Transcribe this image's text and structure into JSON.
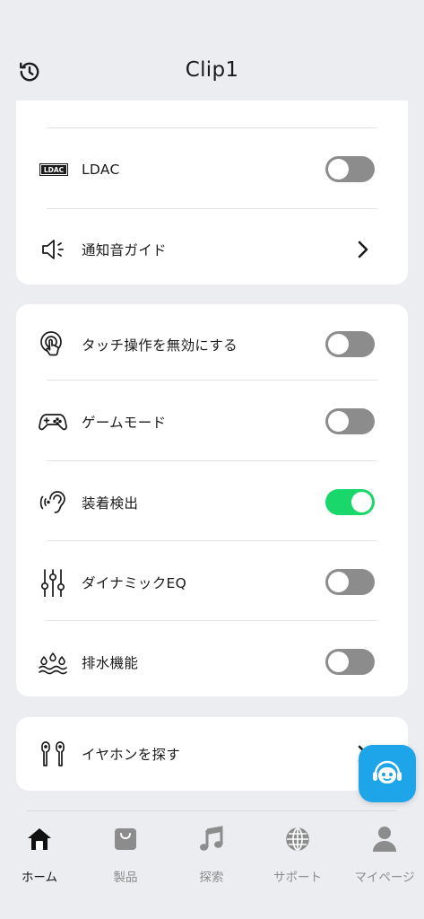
{
  "header": {
    "title": "Clip1",
    "history_icon": "history-icon"
  },
  "settings": {
    "group1": [
      {
        "id": "ldac",
        "label": "LDAC",
        "control": "toggle",
        "on": false,
        "icon": "ldac-icon",
        "badge_text": "LDAC"
      },
      {
        "id": "notification-guide",
        "label": "通知音ガイド",
        "control": "chevron",
        "icon": "speaker-icon"
      }
    ],
    "group2": [
      {
        "id": "disable-touch",
        "label": "タッチ操作を無効にする",
        "control": "toggle",
        "on": false,
        "icon": "touch-icon"
      },
      {
        "id": "game-mode",
        "label": "ゲームモード",
        "control": "toggle",
        "on": false,
        "icon": "gamepad-icon"
      },
      {
        "id": "wear-detection",
        "label": "装着検出",
        "control": "toggle",
        "on": true,
        "icon": "ear-icon"
      },
      {
        "id": "dynamic-eq",
        "label": "ダイナミックEQ",
        "control": "toggle",
        "on": false,
        "icon": "equalizer-icon"
      },
      {
        "id": "drain",
        "label": "排水機能",
        "control": "toggle",
        "on": false,
        "icon": "water-drops-icon"
      }
    ],
    "group3": [
      {
        "id": "find-earphones",
        "label": "イヤホンを探す",
        "control": "chevron",
        "icon": "earbuds-icon"
      }
    ]
  },
  "bottom_nav": [
    {
      "id": "home",
      "label": "ホーム",
      "icon": "home-icon",
      "active": true
    },
    {
      "id": "products",
      "label": "製品",
      "icon": "bag-icon",
      "active": false
    },
    {
      "id": "explore",
      "label": "探索",
      "icon": "music-note-icon",
      "active": false
    },
    {
      "id": "support",
      "label": "サポート",
      "icon": "globe-icon",
      "active": false
    },
    {
      "id": "mypage",
      "label": "マイページ",
      "icon": "person-icon",
      "active": false
    }
  ],
  "colors": {
    "background": "#ECEDF0",
    "toggle_on": "#19D76A",
    "toggle_off": "#8C8C8C",
    "fab": "#1EA4E9"
  },
  "fab": {
    "icon": "headset-bot-icon"
  }
}
